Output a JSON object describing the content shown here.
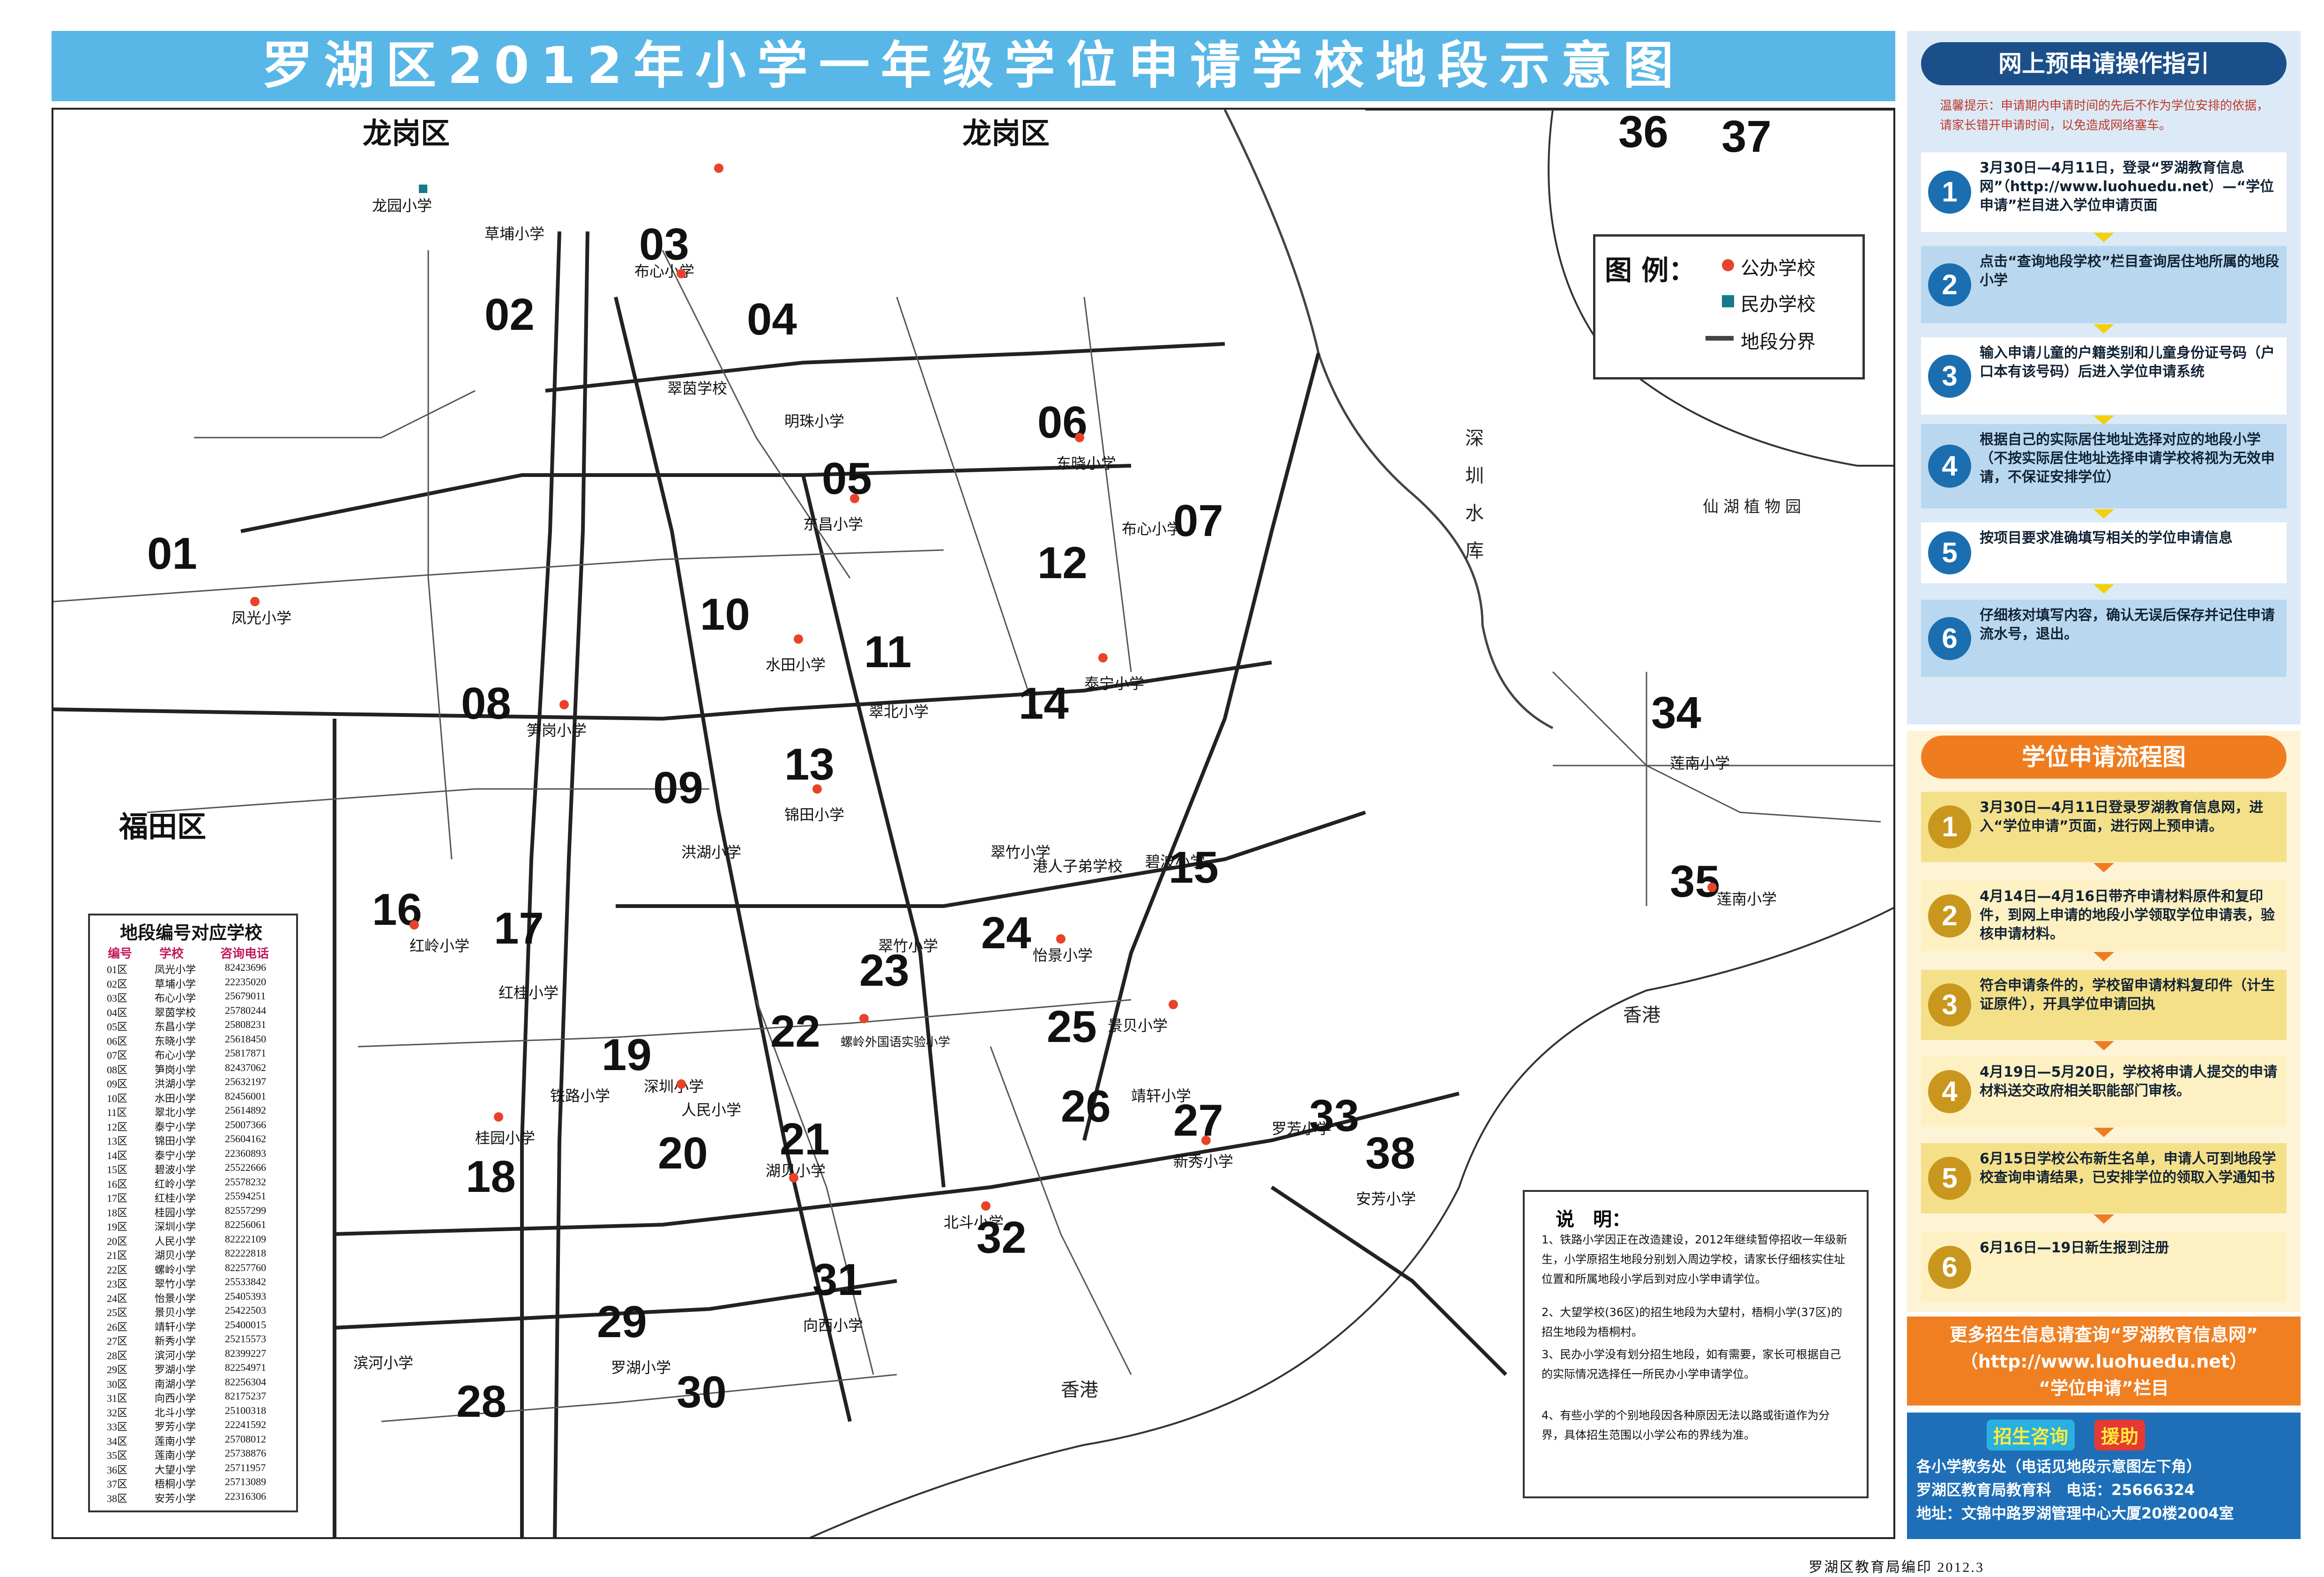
{
  "title": "罗湖区2012年小学一年级学位申请学校地段示意图",
  "map": {
    "zone_numbers": [
      "01",
      "02",
      "03",
      "04",
      "05",
      "06",
      "07",
      "08",
      "09",
      "10",
      "11",
      "12",
      "13",
      "14",
      "15",
      "16",
      "17",
      "18",
      "19",
      "20",
      "21",
      "22",
      "23",
      "24",
      "25",
      "26",
      "27",
      "28",
      "29",
      "30",
      "31",
      "32",
      "33",
      "34",
      "35",
      "36",
      "37",
      "38"
    ],
    "district_labels": [
      "龙岗区",
      "龙岗区",
      "福田区",
      "香港",
      "香港",
      "深圳水库",
      "仙湖植物园"
    ],
    "schools": [
      "龙园小学",
      "草埔小学",
      "布心小学",
      "翠茵学校",
      "东昌小学",
      "东晓小学",
      "布心小学",
      "笋岗小学",
      "洪湖小学",
      "水田小学",
      "翠北小学",
      "泰宁小学",
      "锦田小学",
      "翠竹小学",
      "碧波小学",
      "红岭小学",
      "红桂小学",
      "桂园小学",
      "铁路小学",
      "深圳小学",
      "人民小学",
      "螺岭外国语实验小学",
      "翠竹小学",
      "怡景小学",
      "景贝小学",
      "靖轩小学",
      "新秀小学",
      "滨河小学",
      "罗湖小学",
      "湖贝小学",
      "向西小学",
      "北斗小学",
      "莲南小学",
      "莲南小学",
      "罗芳小学",
      "安芳小学",
      "凤光小学",
      "明珠小学",
      "港人子弟学校"
    ]
  },
  "legend": {
    "title": "图 例：",
    "public_label": "公办学校",
    "private_label": "民办学校",
    "boundary_label": "地段分界",
    "public_color": "#e8432a",
    "private_color": "#157a8a"
  },
  "table": {
    "title": "地段编号对应学校",
    "headers": [
      "编号",
      "学校",
      "咨询电话"
    ],
    "rows": [
      [
        "01区",
        "凤光小学",
        "82423696"
      ],
      [
        "02区",
        "草埔小学",
        "22235020"
      ],
      [
        "03区",
        "布心小学",
        "25679011"
      ],
      [
        "04区",
        "翠茵学校",
        "25780244"
      ],
      [
        "05区",
        "东昌小学",
        "25808231"
      ],
      [
        "06区",
        "东晓小学",
        "25618450"
      ],
      [
        "07区",
        "布心小学",
        "25817871"
      ],
      [
        "08区",
        "笋岗小学",
        "82437062"
      ],
      [
        "09区",
        "洪湖小学",
        "25632197"
      ],
      [
        "10区",
        "水田小学",
        "82456001"
      ],
      [
        "11区",
        "翠北小学",
        "25614892"
      ],
      [
        "12区",
        "泰宁小学",
        "25007366"
      ],
      [
        "13区",
        "锦田小学",
        "25604162"
      ],
      [
        "14区",
        "泰宁小学",
        "22360893"
      ],
      [
        "15区",
        "碧波小学",
        "25522666"
      ],
      [
        "16区",
        "红岭小学",
        "25578232"
      ],
      [
        "17区",
        "红桂小学",
        "25594251"
      ],
      [
        "18区",
        "桂园小学",
        "82557299"
      ],
      [
        "19区",
        "深圳小学",
        "82256061"
      ],
      [
        "20区",
        "人民小学",
        "82222109"
      ],
      [
        "21区",
        "湖贝小学",
        "82222818"
      ],
      [
        "22区",
        "螺岭小学",
        "82257760"
      ],
      [
        "23区",
        "翠竹小学",
        "25533842"
      ],
      [
        "24区",
        "怡景小学",
        "25405393"
      ],
      [
        "25区",
        "景贝小学",
        "25422503"
      ],
      [
        "26区",
        "靖轩小学",
        "25400015"
      ],
      [
        "27区",
        "新秀小学",
        "25215573"
      ],
      [
        "28区",
        "滨河小学",
        "82399227"
      ],
      [
        "29区",
        "罗湖小学",
        "82254971"
      ],
      [
        "30区",
        "南湖小学",
        "82256304"
      ],
      [
        "31区",
        "向西小学",
        "82175237"
      ],
      [
        "32区",
        "北斗小学",
        "25100318"
      ],
      [
        "33区",
        "罗芳小学",
        "22241592"
      ],
      [
        "34区",
        "莲南小学",
        "25708012"
      ],
      [
        "35区",
        "莲南小学",
        "25738876"
      ],
      [
        "36区",
        "大望小学",
        "25711957"
      ],
      [
        "37区",
        "梧桐小学",
        "25713089"
      ],
      [
        "38区",
        "安芳小学",
        "22316306"
      ]
    ]
  },
  "notes": {
    "heading": "说　明：",
    "items": [
      "1、铁路小学因正在改造建设，2012年继续暂停招收一年级新生，小学原招生地段分别划入周边学校，请家长仔细核实住址位置和所属地段小学后到对应小学申请学位。",
      "2、大望学校(36区)的招生地段为大望村，梧桐小学(37区)的招生地段为梧桐村。",
      "3、民办小学没有划分招生地段，如有需要，家长可根据自己的实际情况选择任一所民办小学申请学位。",
      "4、有些小学的个别地段因各种原因无法以路或街道作为分界，具体招生范围以小学公布的界线为准。"
    ]
  },
  "online_guide": {
    "title": "网上预申请操作指引",
    "tip": "温馨提示：申请期内申请时间的先后不作为学位安排的依据，请家长错开申请时间，以免造成网络塞车。",
    "steps": [
      {
        "n": "1",
        "text": "3月30日—4月11日，登录“罗湖教育信息网”（http://www.luohuedu.net）—“学位申请”栏目进入学位申请页面"
      },
      {
        "n": "2",
        "text": "点击“查询地段学校”栏目查询居住地所属的地段小学"
      },
      {
        "n": "3",
        "text": "输入申请儿童的户籍类别和儿童身份证号码（户口本有该号码）后进入学位申请系统"
      },
      {
        "n": "4",
        "text": "根据自己的实际居住地址选择对应的地段小学（不按实际居住地址选择申请学校将视为无效申请，不保证安排学位）"
      },
      {
        "n": "5",
        "text": "按项目要求准确填写相关的学位申请信息"
      },
      {
        "n": "6",
        "text": "仔细核对填写内容，确认无误后保存并记住申请流水号，退出。"
      }
    ]
  },
  "process": {
    "title": "学位申请流程图",
    "steps": [
      {
        "n": "1",
        "text": "3月30日—4月11日登录罗湖教育信息网，进入“学位申请”页面，进行网上预申请。"
      },
      {
        "n": "2",
        "text": "4月14日—4月16日带齐申请材料原件和复印件，到网上申请的地段小学领取学位申请表，验核申请材料。"
      },
      {
        "n": "3",
        "text": "符合申请条件的，学校留申请材料复印件（计生证原件），开具学位申请回执"
      },
      {
        "n": "4",
        "text": "4月19日—5月20日，学校将申请人提交的申请材料送交政府相关职能部门审核。"
      },
      {
        "n": "5",
        "text": "6月15日学校公布新生名单，申请人可到地段学校查询申请结果，已安排学位的领取入学通知书"
      },
      {
        "n": "6",
        "text": "6月16日—19日新生报到注册"
      }
    ]
  },
  "more_info": {
    "line1": "更多招生信息请查询“罗湖教育信息网”",
    "line2": "（http://www.luohuedu.net）",
    "line3": "“学位申请”栏目"
  },
  "contact": {
    "badge": "招生咨询",
    "badge2": "援助",
    "line1": "各小学教务处（电话见地段示意图左下角）",
    "line2": "罗湖区教育局教育科　电话：25666324",
    "line3": "地址：文锦中路罗湖管理中心大厦20楼2004室"
  },
  "credit": "罗湖区教育局编印 2012.3",
  "colors": {
    "banner": "#58b7e6",
    "guide_dark": "#1b4f8a",
    "guide_light": "#6fa9d8",
    "guide_step_bg": "#b9d8ef",
    "process_orange": "#ef7d1f",
    "process_step_bg": "#f5e08a",
    "circle_gold": "#c9971d",
    "more_info_bg": "#f07f22",
    "contact_bg": "#1e6fb8"
  }
}
